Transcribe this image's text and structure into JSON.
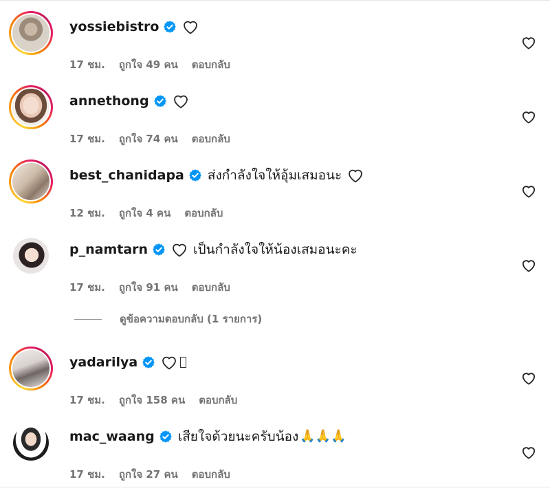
{
  "colors": {
    "verified": "#0095f6",
    "meta_text": "#737373",
    "text": "#262626"
  },
  "icons": {
    "like": "heart-outline-icon",
    "verified": "verified-badge-icon"
  },
  "comments": [
    {
      "username": "yossiebistro",
      "text": "",
      "time": "17 ชม.",
      "likes": "ถูกใจ 49 คน",
      "reply": "ตอบกลับ",
      "story_ring": true
    },
    {
      "username": "annethong",
      "text": "",
      "time": "17 ชม.",
      "likes": "ถูกใจ 74 คน",
      "reply": "ตอบกลับ",
      "story_ring": true
    },
    {
      "username": "best_chanidapa",
      "text": "ส่งกำลังใจให้อุ้มเสมอนะ",
      "time": "12 ชม.",
      "likes": "ถูกใจ 4 คน",
      "reply": "ตอบกลับ",
      "story_ring": true
    },
    {
      "username": "p_namtarn",
      "text": "เป็นกำลังใจให้น้องเสมอนะคะ",
      "time": "17 ชม.",
      "likes": "ถูกใจ 91 คน",
      "reply": "ตอบกลับ",
      "story_ring": false
    },
    {
      "username": "yadarilya",
      "text": "",
      "time": "17 ชม.",
      "likes": "ถูกใจ 158 คน",
      "reply": "ตอบกลับ",
      "story_ring": true
    },
    {
      "username": "mac_waang",
      "text": "เสียใจด้วยนะครับน้อง",
      "emoji": "🙏🙏🙏",
      "time": "17 ชม.",
      "likes": "ถูกใจ 27 คน",
      "reply": "ตอบกลับ",
      "story_ring": false
    }
  ],
  "view_replies": "ดูข้อความตอบกลับ (1 รายการ)"
}
